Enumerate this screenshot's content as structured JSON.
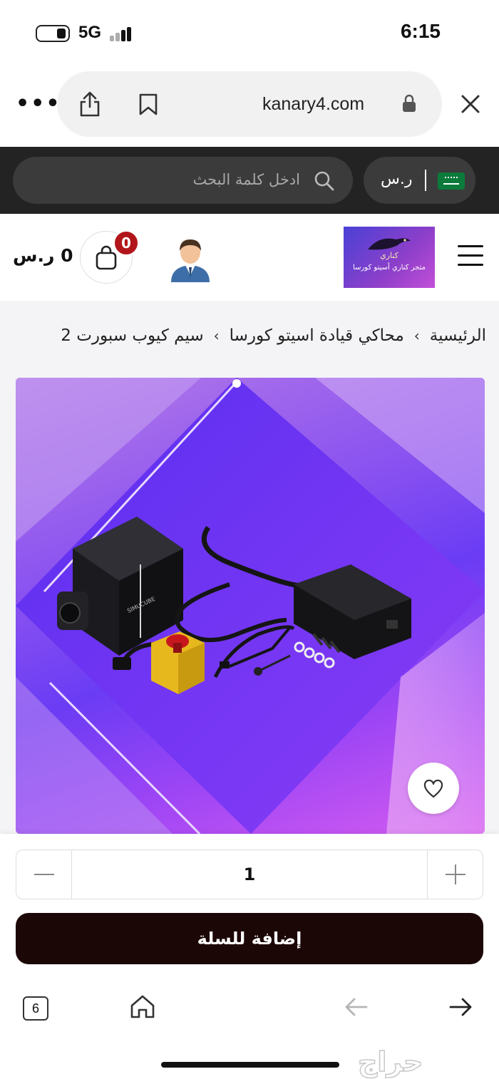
{
  "status": {
    "network": "5G",
    "time": "6:15"
  },
  "browser": {
    "url": "kanary4.com",
    "more": "•••"
  },
  "search": {
    "placeholder": "ادخل كلمة البحث",
    "currency": "ر.س"
  },
  "header": {
    "cart_total": "0 ر.س",
    "cart_count": "0",
    "logo_line1": "كناري",
    "logo_line2": "متجر كناري أسيتو كورسا"
  },
  "breadcrumb": {
    "home": "الرئيسية",
    "category": "محاكي قيادة اسيتو كورسا",
    "current": "سيم كيوب سبورت 2",
    "separator": "›"
  },
  "product": {
    "brand_mark": "SIMUCUBE"
  },
  "buy": {
    "quantity": "1",
    "add_to_cart": "إضافة للسلة"
  },
  "toolbar": {
    "tab_count": "6"
  },
  "watermark": "حراج",
  "colors": {
    "accent": "#b2161b",
    "button": "#1c0707",
    "strip": "#232323"
  }
}
